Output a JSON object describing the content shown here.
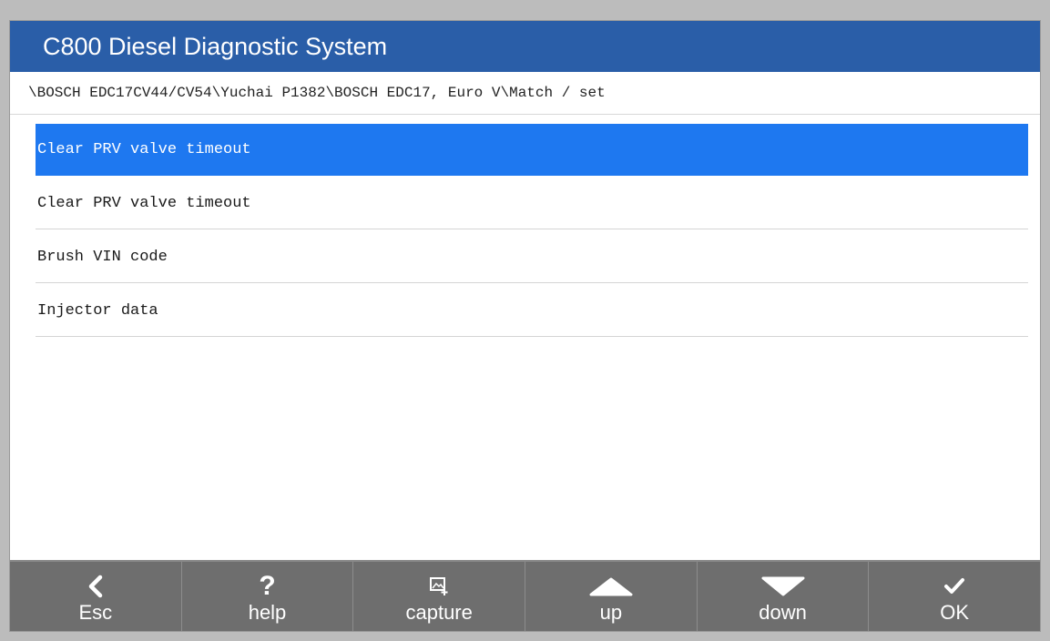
{
  "app": {
    "title": "C800 Diesel Diagnostic System"
  },
  "breadcrumb": "\\BOSCH EDC17CV44/CV54\\Yuchai P1382\\BOSCH EDC17, Euro V\\Match / set",
  "menu": {
    "selected_index": 0,
    "items": [
      {
        "label": "Clear PRV valve timeout"
      },
      {
        "label": "Clear PRV valve timeout"
      },
      {
        "label": "Brush VIN code"
      },
      {
        "label": "Injector data"
      }
    ]
  },
  "toolbar": {
    "buttons": [
      {
        "label": "Esc",
        "icon": "chevron-left-icon"
      },
      {
        "label": "help",
        "icon": "question-mark-icon"
      },
      {
        "label": "capture",
        "icon": "screenshot-icon"
      },
      {
        "label": "up",
        "icon": "triangle-up-icon"
      },
      {
        "label": "down",
        "icon": "triangle-down-icon"
      },
      {
        "label": "OK",
        "icon": "checkmark-icon"
      }
    ]
  },
  "colors": {
    "title_bar": "#2a5ea8",
    "selection": "#1e78f0",
    "toolbar": "#6e6e6e"
  }
}
